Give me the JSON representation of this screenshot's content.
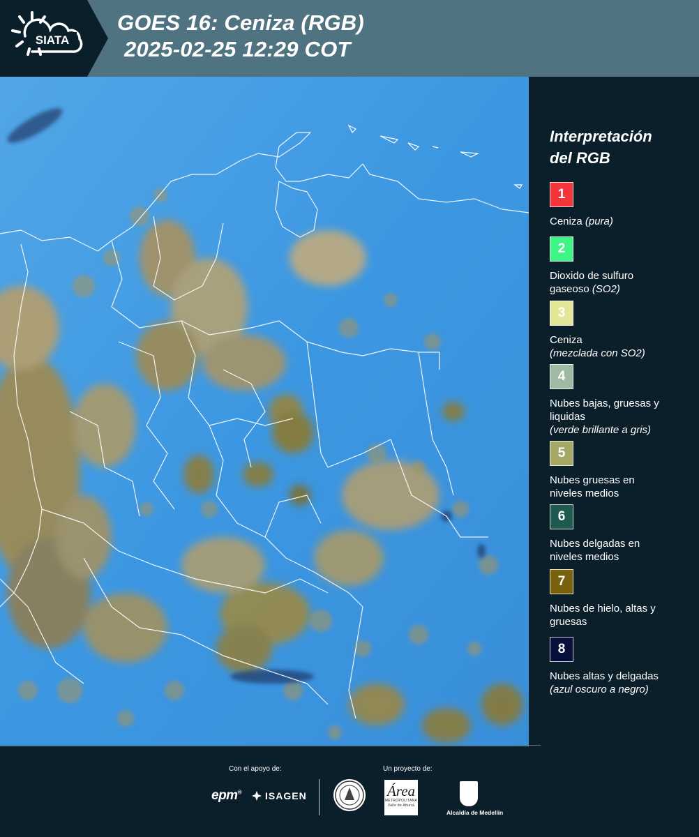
{
  "header": {
    "logo_text": "SIATA",
    "title": "GOES 16: Ceniza (RGB)",
    "timestamp": "2025-02-25 12:29 COT"
  },
  "map": {
    "background_color": "#3f9be3",
    "cloud_color": "#a38d52",
    "border_color": "#ffffff"
  },
  "legend": {
    "title_lines": [
      "Interpretación",
      "del RGB"
    ],
    "items": [
      {
        "number": "1",
        "color": "#f2363b",
        "label_lines": [
          "Ceniza "
        ],
        "label_italic": [
          "(pura)"
        ]
      },
      {
        "number": "2",
        "color": "#3ff586",
        "label_lines": [
          "Dioxido de sulfuro",
          "gaseoso "
        ],
        "label_italic": [
          "(SO2)"
        ]
      },
      {
        "number": "3",
        "color": "#e4e697",
        "label_lines": [
          "Ceniza"
        ],
        "label_italic": [
          "(mezclada con SO2)"
        ]
      },
      {
        "number": "4",
        "color": "#9fb9a2",
        "label_lines": [
          "Nubes bajas, gruesas y",
          "liquidas"
        ],
        "label_italic": [
          "(verde brillante a gris)"
        ]
      },
      {
        "number": "5",
        "color": "#a6a867",
        "label_lines": [
          "Nubes gruesas en",
          "niveles medios"
        ],
        "label_italic": []
      },
      {
        "number": "6",
        "color": "#1f5a50",
        "label_lines": [
          "Nubes delgadas en",
          "niveles medios"
        ],
        "label_italic": []
      },
      {
        "number": "7",
        "color": "#7a620c",
        "label_lines": [
          "Nubes de hielo, altas y",
          "gruesas"
        ],
        "label_italic": []
      },
      {
        "number": "8",
        "color": "#07103a",
        "label_lines": [
          "Nubes altas y delgadas"
        ],
        "label_italic": [
          "(azul oscuro a negro)"
        ]
      }
    ]
  },
  "footer": {
    "support_label": "Con el apoyo de:",
    "project_label": "Un proyecto de:",
    "epm_logo": "epm",
    "isagen_logo": "ISAGEN",
    "area_logo_big": "Área",
    "area_logo_small_1": "METROPOLITANA",
    "area_logo_small_2": "Valle de Aburrá",
    "alcaldia_label": "Alcaldía de Medellín"
  }
}
